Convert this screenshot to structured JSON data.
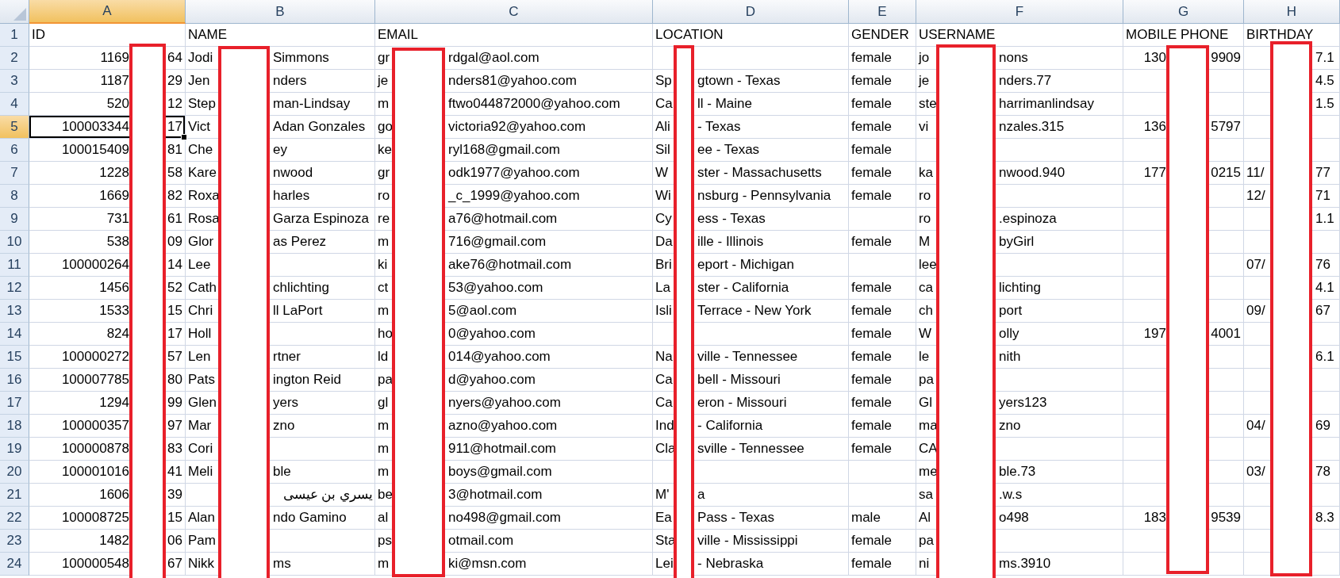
{
  "sheet": {
    "columns": [
      {
        "letter": "A",
        "selected": true
      },
      {
        "letter": "B",
        "selected": false
      },
      {
        "letter": "C",
        "selected": false
      },
      {
        "letter": "D",
        "selected": false
      },
      {
        "letter": "E",
        "selected": false
      },
      {
        "letter": "F",
        "selected": false
      },
      {
        "letter": "G",
        "selected": false
      },
      {
        "letter": "H",
        "selected": false
      }
    ],
    "rows": [
      {
        "number": "1",
        "selected": false,
        "cells": [
          {
            "text": "ID"
          },
          {
            "text": "NAME"
          },
          {
            "text": "EMAIL"
          },
          {
            "text": "LOCATION"
          },
          {
            "text": "GENDER"
          },
          {
            "text": "USERNAME"
          },
          {
            "text": "MOBILE PHONE"
          },
          {
            "text": "BIRTHDAY"
          }
        ]
      },
      {
        "number": "2",
        "selected": false,
        "cells": [
          {
            "before": "1169",
            "after": "64"
          },
          {
            "before": "Jodi",
            "after": "Simmons"
          },
          {
            "before": "gr",
            "after": "rdgal@aol.com"
          },
          {},
          {
            "text": "female"
          },
          {
            "before": "jo",
            "after": "nons"
          },
          {
            "before": "130",
            "after": "9909"
          },
          {
            "after": "7.1"
          }
        ]
      },
      {
        "number": "3",
        "selected": false,
        "cells": [
          {
            "before": "1187",
            "after": "29"
          },
          {
            "before": "Jen",
            "after": "nders"
          },
          {
            "before": "je",
            "after": "nders81@yahoo.com"
          },
          {
            "before": "Sp",
            "after": "gtown - Texas"
          },
          {
            "text": "female"
          },
          {
            "before": "je",
            "after": "nders.77"
          },
          {},
          {
            "after": "4.5"
          }
        ]
      },
      {
        "number": "4",
        "selected": false,
        "cells": [
          {
            "before": "520",
            "after": "12"
          },
          {
            "before": "Step",
            "after": "man-Lindsay"
          },
          {
            "before": "m",
            "after": "ftwo044872000@yahoo.com"
          },
          {
            "before": "Ca",
            "after": "ll - Maine"
          },
          {
            "text": "female"
          },
          {
            "before": "ste",
            "after": "harrimanlindsay"
          },
          {},
          {
            "after": "1.5"
          }
        ]
      },
      {
        "number": "5",
        "selected": true,
        "cells": [
          {
            "before": "100003344",
            "after": "17"
          },
          {
            "before": "Vict",
            "after": "Adan Gonzales"
          },
          {
            "before": "go",
            "after": "victoria92@yahoo.com"
          },
          {
            "before": "Ali",
            "after": "- Texas"
          },
          {
            "text": "female"
          },
          {
            "before": "vi",
            "after": "nzales.315"
          },
          {
            "before": "136",
            "after": "5797"
          },
          {}
        ]
      },
      {
        "number": "6",
        "selected": false,
        "cells": [
          {
            "before": "100015409",
            "after": "81"
          },
          {
            "before": "Che",
            "after": "ey"
          },
          {
            "before": "ke",
            "after": "ryl168@gmail.com"
          },
          {
            "before": "Sil",
            "after": "ee - Texas"
          },
          {
            "text": "female"
          },
          {},
          {},
          {}
        ]
      },
      {
        "number": "7",
        "selected": false,
        "cells": [
          {
            "before": "1228",
            "after": "58"
          },
          {
            "before": "Kare",
            "after": "nwood"
          },
          {
            "before": "gr",
            "after": "odk1977@yahoo.com"
          },
          {
            "before": "W",
            "after": "ster - Massachusetts"
          },
          {
            "text": "female"
          },
          {
            "before": "ka",
            "after": "nwood.940"
          },
          {
            "before": "177",
            "after": "0215"
          },
          {
            "before": "11/",
            "after": "77"
          }
        ]
      },
      {
        "number": "8",
        "selected": false,
        "cells": [
          {
            "before": "1669",
            "after": "82"
          },
          {
            "before": "Roxa",
            "after": "harles"
          },
          {
            "before": "ro",
            "after": "_c_1999@yahoo.com"
          },
          {
            "before": "Wi",
            "after": "nsburg - Pennsylvania"
          },
          {
            "text": "female"
          },
          {
            "before": "ro"
          },
          {},
          {
            "before": "12/",
            "after": "71"
          }
        ]
      },
      {
        "number": "9",
        "selected": false,
        "cells": [
          {
            "before": "731",
            "after": "61"
          },
          {
            "before": "Rosa",
            "after": "Garza Espinoza"
          },
          {
            "before": "re",
            "after": "a76@hotmail.com"
          },
          {
            "before": "Cy",
            "after": "ess - Texas"
          },
          {},
          {
            "before": "ro",
            "after": ".espinoza"
          },
          {},
          {
            "after": "1.1"
          }
        ]
      },
      {
        "number": "10",
        "selected": false,
        "cells": [
          {
            "before": "538",
            "after": "09"
          },
          {
            "before": "Glor",
            "after": "as Perez"
          },
          {
            "before": "m",
            "after": "716@gmail.com"
          },
          {
            "before": "Da",
            "after": "ille - Illinois"
          },
          {
            "text": "female"
          },
          {
            "before": "M",
            "after": "byGirl"
          },
          {},
          {}
        ]
      },
      {
        "number": "11",
        "selected": false,
        "cells": [
          {
            "before": "100000264",
            "after": "14"
          },
          {
            "before": "Lee"
          },
          {
            "before": "ki",
            "after": "ake76@hotmail.com"
          },
          {
            "before": "Bri",
            "after": "eport - Michigan"
          },
          {},
          {
            "before": "lee"
          },
          {},
          {
            "before": "07/",
            "after": "76"
          }
        ]
      },
      {
        "number": "12",
        "selected": false,
        "cells": [
          {
            "before": "1456",
            "after": "52"
          },
          {
            "before": "Cath",
            "after": "chlichting"
          },
          {
            "before": "ct",
            "after": "53@yahoo.com"
          },
          {
            "before": "La",
            "after": "ster - California"
          },
          {
            "text": "female"
          },
          {
            "before": "ca",
            "after": "lichting"
          },
          {},
          {
            "after": "4.1"
          }
        ]
      },
      {
        "number": "13",
        "selected": false,
        "cells": [
          {
            "before": "1533",
            "after": "15"
          },
          {
            "before": "Chri",
            "after": "ll LaPort"
          },
          {
            "before": "m",
            "after": "5@aol.com"
          },
          {
            "before": "Isli",
            "after": "Terrace - New York"
          },
          {
            "text": "female"
          },
          {
            "before": "ch",
            "after": "port"
          },
          {},
          {
            "before": "09/",
            "after": "67"
          }
        ]
      },
      {
        "number": "14",
        "selected": false,
        "cells": [
          {
            "before": "824",
            "after": "17"
          },
          {
            "before": "Holl"
          },
          {
            "before": "ho",
            "after": "0@yahoo.com"
          },
          {},
          {
            "text": "female"
          },
          {
            "before": "W",
            "after": "olly"
          },
          {
            "before": "197",
            "after": "4001"
          },
          {}
        ]
      },
      {
        "number": "15",
        "selected": false,
        "cells": [
          {
            "before": "100000272",
            "after": "57"
          },
          {
            "before": "Len",
            "after": "rtner"
          },
          {
            "before": "ld",
            "after": "014@yahoo.com"
          },
          {
            "before": "Na",
            "after": "ville - Tennessee"
          },
          {
            "text": "female"
          },
          {
            "before": "le",
            "after": "nith"
          },
          {},
          {
            "after": "6.1"
          }
        ]
      },
      {
        "number": "16",
        "selected": false,
        "cells": [
          {
            "before": "100007785",
            "after": "80"
          },
          {
            "before": "Pats",
            "after": "ington Reid"
          },
          {
            "before": "pa",
            "after": "d@yahoo.com"
          },
          {
            "before": "Ca",
            "after": "bell - Missouri"
          },
          {
            "text": "female"
          },
          {
            "before": "pa"
          },
          {},
          {}
        ]
      },
      {
        "number": "17",
        "selected": false,
        "cells": [
          {
            "before": "1294",
            "after": "99"
          },
          {
            "before": "Glen",
            "after": "yers"
          },
          {
            "before": "gl",
            "after": "nyers@yahoo.com"
          },
          {
            "before": "Ca",
            "after": "eron - Missouri"
          },
          {
            "text": "female"
          },
          {
            "before": "Gl",
            "after": "yers123"
          },
          {},
          {}
        ]
      },
      {
        "number": "18",
        "selected": false,
        "cells": [
          {
            "before": "100000357",
            "after": "97"
          },
          {
            "before": "Mar",
            "after": "zno"
          },
          {
            "before": "m",
            "after": "azno@yahoo.com"
          },
          {
            "before": "Ind",
            "after": "- California"
          },
          {
            "text": "female"
          },
          {
            "before": "ma",
            "after": "zno"
          },
          {},
          {
            "before": "04/",
            "after": "69"
          }
        ]
      },
      {
        "number": "19",
        "selected": false,
        "cells": [
          {
            "before": "100000878",
            "after": "83"
          },
          {
            "before": "Cori"
          },
          {
            "before": "m",
            "after": "911@hotmail.com"
          },
          {
            "before": "Cla",
            "after": "sville - Tennessee"
          },
          {
            "text": "female"
          },
          {
            "before": "CA"
          },
          {},
          {}
        ]
      },
      {
        "number": "20",
        "selected": false,
        "cells": [
          {
            "before": "100001016",
            "after": "41"
          },
          {
            "before": "Meli",
            "after": "ble"
          },
          {
            "before": "m",
            "after": "boys@gmail.com"
          },
          {},
          {},
          {
            "before": "me",
            "after": "ble.73"
          },
          {},
          {
            "before": "03/",
            "after": "78"
          }
        ]
      },
      {
        "number": "21",
        "selected": false,
        "cells": [
          {
            "before": "1606",
            "after": "39"
          },
          {
            "after": "يسري بن عيسى"
          },
          {
            "before": "be",
            "after": "3@hotmail.com"
          },
          {
            "before": "M'",
            "after": "a"
          },
          {},
          {
            "before": "sa",
            "after": ".w.s"
          },
          {},
          {}
        ]
      },
      {
        "number": "22",
        "selected": false,
        "cells": [
          {
            "before": "100008725",
            "after": "15"
          },
          {
            "before": "Alan",
            "after": "ndo Gamino"
          },
          {
            "before": "al",
            "after": "no498@gmail.com"
          },
          {
            "before": "Ea",
            "after": "Pass - Texas"
          },
          {
            "text": "male"
          },
          {
            "before": "Al",
            "after": "o498"
          },
          {
            "before": "183",
            "after": "9539"
          },
          {
            "after": "8.3"
          }
        ]
      },
      {
        "number": "23",
        "selected": false,
        "cells": [
          {
            "before": "1482",
            "after": "06"
          },
          {
            "before": "Pam"
          },
          {
            "before": "ps",
            "after": "otmail.com"
          },
          {
            "before": "Sta",
            "after": "ville - Mississippi"
          },
          {
            "text": "female"
          },
          {
            "before": "pa"
          },
          {},
          {}
        ]
      },
      {
        "number": "24",
        "selected": false,
        "cells": [
          {
            "before": "100000548",
            "after": "67"
          },
          {
            "before": "Nikk",
            "after": "ms"
          },
          {
            "before": "m",
            "after": "ki@msn.com"
          },
          {
            "before": "Lei",
            "after": "- Nebraska"
          },
          {
            "text": "female"
          },
          {
            "before": "ni",
            "after": "ms.3910"
          },
          {},
          {}
        ]
      }
    ]
  }
}
